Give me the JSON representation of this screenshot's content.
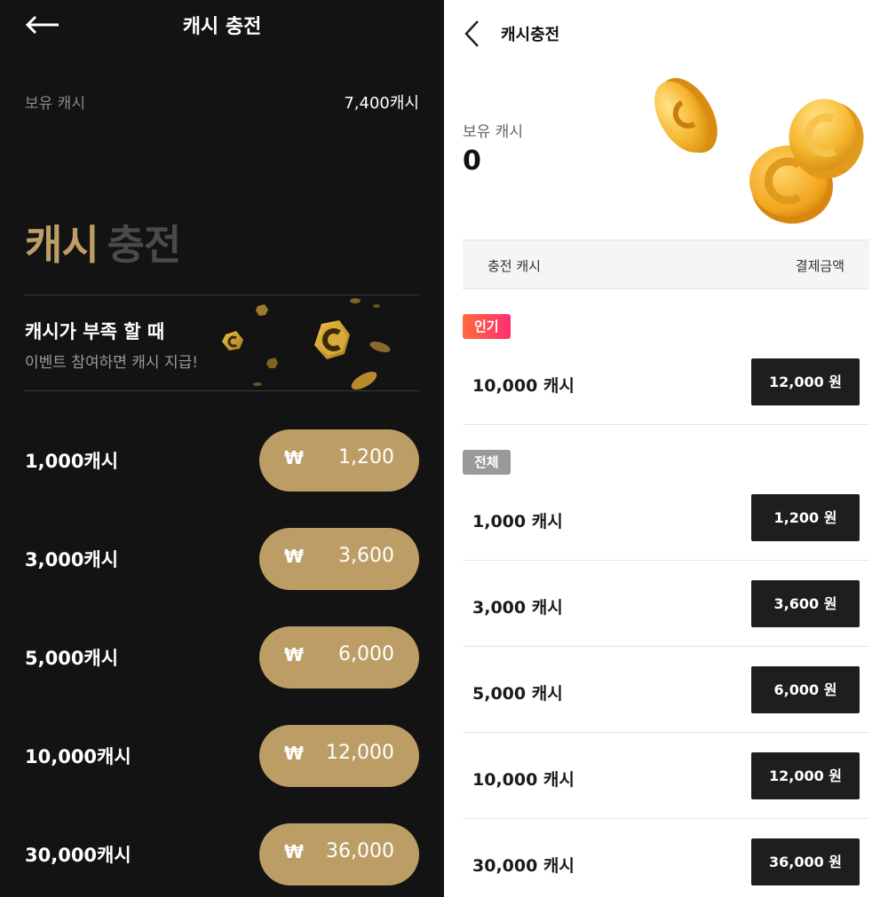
{
  "dark": {
    "title": "캐시 충전",
    "balance_label": "보유 캐시",
    "balance_value": "7,400캐시",
    "hero_word1": "캐시",
    "hero_word2": "충전",
    "banner": {
      "title": "캐시가 부족 할 때",
      "subtitle": "이벤트 참여하면 캐시 지급!"
    },
    "currency_symbol": "₩",
    "options": [
      {
        "label": "1,000캐시",
        "price": "1,200"
      },
      {
        "label": "3,000캐시",
        "price": "3,600"
      },
      {
        "label": "5,000캐시",
        "price": "6,000"
      },
      {
        "label": "10,000캐시",
        "price": "12,000"
      },
      {
        "label": "30,000캐시",
        "price": "36,000"
      }
    ],
    "colors": {
      "background": "#131313",
      "accent_gold": "#bc9d66",
      "muted_text": "#8b8b8b"
    }
  },
  "light": {
    "title": "캐시충전",
    "balance_label": "보유 캐시",
    "balance_value": "0",
    "table_header": {
      "left": "충전 캐시",
      "right": "결제금액"
    },
    "popular_badge": "인기",
    "all_badge": "전체",
    "popular_options": [
      {
        "label": "10,000 캐시",
        "price": "12,000 원"
      }
    ],
    "options": [
      {
        "label": "1,000 캐시",
        "price": "1,200 원"
      },
      {
        "label": "3,000 캐시",
        "price": "3,600 원"
      },
      {
        "label": "5,000 캐시",
        "price": "6,000 원"
      },
      {
        "label": "10,000 캐시",
        "price": "12,000 원"
      },
      {
        "label": "30,000 캐시",
        "price": "36,000 원"
      }
    ],
    "colors": {
      "button": "#1e1e1e",
      "badge_hot_start": "#ff6a3d",
      "badge_hot_end": "#ff2f6e",
      "badge_all": "#9a9a9a"
    }
  }
}
